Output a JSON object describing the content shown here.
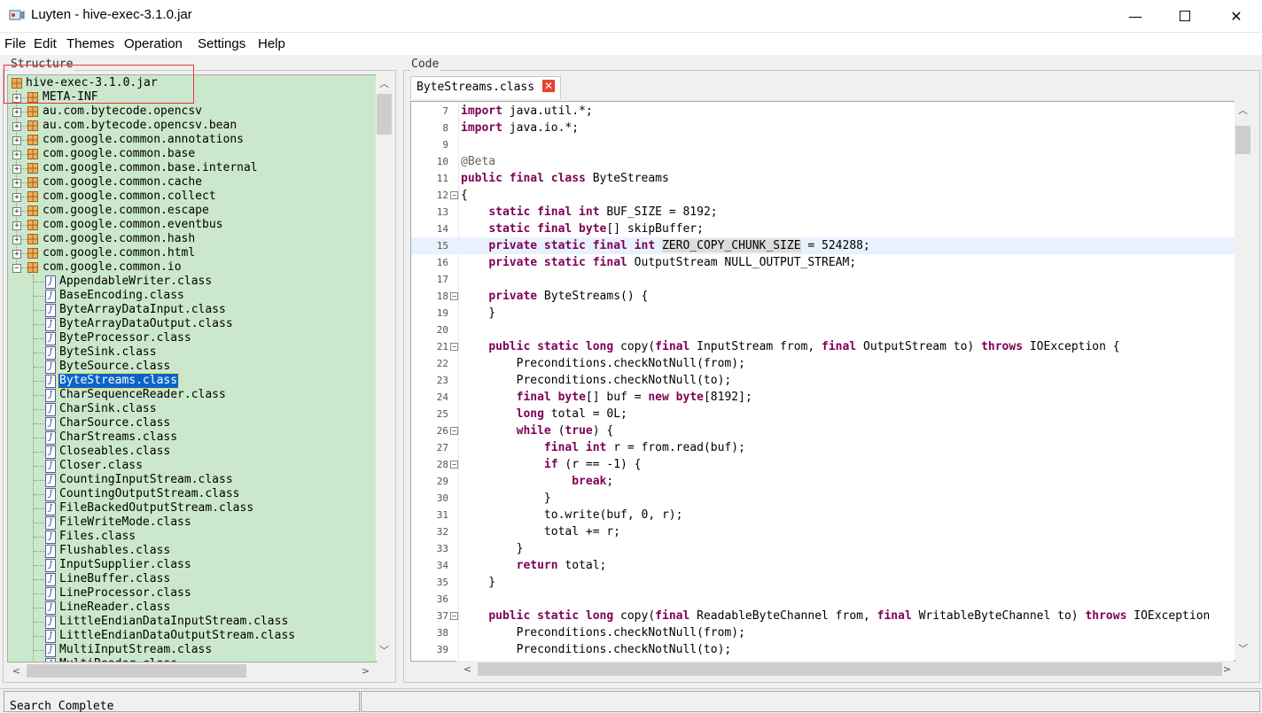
{
  "window": {
    "title": "Luyten - hive-exec-3.1.0.jar",
    "minimize_glyph": "—",
    "close_glyph": "✕"
  },
  "menu": [
    "File",
    "Edit",
    "Themes",
    "Operation",
    "Settings",
    "Help"
  ],
  "structure": {
    "label": "Structure",
    "tree": [
      {
        "label": "hive-exec-3.1.0.jar",
        "type": "jar",
        "level": 0,
        "expander": "",
        "selected": false
      },
      {
        "label": "META-INF",
        "type": "package",
        "level": 1,
        "expander": "+",
        "selected": false
      },
      {
        "label": "au.com.bytecode.opencsv",
        "type": "package",
        "level": 1,
        "expander": "+",
        "selected": false
      },
      {
        "label": "au.com.bytecode.opencsv.bean",
        "type": "package",
        "level": 1,
        "expander": "+",
        "selected": false
      },
      {
        "label": "com.google.common.annotations",
        "type": "package",
        "level": 1,
        "expander": "+",
        "selected": false
      },
      {
        "label": "com.google.common.base",
        "type": "package",
        "level": 1,
        "expander": "+",
        "selected": false
      },
      {
        "label": "com.google.common.base.internal",
        "type": "package",
        "level": 1,
        "expander": "+",
        "selected": false
      },
      {
        "label": "com.google.common.cache",
        "type": "package",
        "level": 1,
        "expander": "+",
        "selected": false
      },
      {
        "label": "com.google.common.collect",
        "type": "package",
        "level": 1,
        "expander": "+",
        "selected": false
      },
      {
        "label": "com.google.common.escape",
        "type": "package",
        "level": 1,
        "expander": "+",
        "selected": false
      },
      {
        "label": "com.google.common.eventbus",
        "type": "package",
        "level": 1,
        "expander": "+",
        "selected": false
      },
      {
        "label": "com.google.common.hash",
        "type": "package",
        "level": 1,
        "expander": "+",
        "selected": false
      },
      {
        "label": "com.google.common.html",
        "type": "package",
        "level": 1,
        "expander": "+",
        "selected": false
      },
      {
        "label": "com.google.common.io",
        "type": "package",
        "level": 1,
        "expander": "−",
        "selected": false
      },
      {
        "label": "AppendableWriter.class",
        "type": "class",
        "level": 2,
        "expander": "",
        "selected": false
      },
      {
        "label": "BaseEncoding.class",
        "type": "class",
        "level": 2,
        "expander": "",
        "selected": false
      },
      {
        "label": "ByteArrayDataInput.class",
        "type": "class",
        "level": 2,
        "expander": "",
        "selected": false
      },
      {
        "label": "ByteArrayDataOutput.class",
        "type": "class",
        "level": 2,
        "expander": "",
        "selected": false
      },
      {
        "label": "ByteProcessor.class",
        "type": "class",
        "level": 2,
        "expander": "",
        "selected": false
      },
      {
        "label": "ByteSink.class",
        "type": "class",
        "level": 2,
        "expander": "",
        "selected": false
      },
      {
        "label": "ByteSource.class",
        "type": "class",
        "level": 2,
        "expander": "",
        "selected": false
      },
      {
        "label": "ByteStreams.class",
        "type": "class",
        "level": 2,
        "expander": "",
        "selected": true
      },
      {
        "label": "CharSequenceReader.class",
        "type": "class",
        "level": 2,
        "expander": "",
        "selected": false
      },
      {
        "label": "CharSink.class",
        "type": "class",
        "level": 2,
        "expander": "",
        "selected": false
      },
      {
        "label": "CharSource.class",
        "type": "class",
        "level": 2,
        "expander": "",
        "selected": false
      },
      {
        "label": "CharStreams.class",
        "type": "class",
        "level": 2,
        "expander": "",
        "selected": false
      },
      {
        "label": "Closeables.class",
        "type": "class",
        "level": 2,
        "expander": "",
        "selected": false
      },
      {
        "label": "Closer.class",
        "type": "class",
        "level": 2,
        "expander": "",
        "selected": false
      },
      {
        "label": "CountingInputStream.class",
        "type": "class",
        "level": 2,
        "expander": "",
        "selected": false
      },
      {
        "label": "CountingOutputStream.class",
        "type": "class",
        "level": 2,
        "expander": "",
        "selected": false
      },
      {
        "label": "FileBackedOutputStream.class",
        "type": "class",
        "level": 2,
        "expander": "",
        "selected": false
      },
      {
        "label": "FileWriteMode.class",
        "type": "class",
        "level": 2,
        "expander": "",
        "selected": false
      },
      {
        "label": "Files.class",
        "type": "class",
        "level": 2,
        "expander": "",
        "selected": false
      },
      {
        "label": "Flushables.class",
        "type": "class",
        "level": 2,
        "expander": "",
        "selected": false
      },
      {
        "label": "InputSupplier.class",
        "type": "class",
        "level": 2,
        "expander": "",
        "selected": false
      },
      {
        "label": "LineBuffer.class",
        "type": "class",
        "level": 2,
        "expander": "",
        "selected": false
      },
      {
        "label": "LineProcessor.class",
        "type": "class",
        "level": 2,
        "expander": "",
        "selected": false
      },
      {
        "label": "LineReader.class",
        "type": "class",
        "level": 2,
        "expander": "",
        "selected": false
      },
      {
        "label": "LittleEndianDataInputStream.class",
        "type": "class",
        "level": 2,
        "expander": "",
        "selected": false
      },
      {
        "label": "LittleEndianDataOutputStream.class",
        "type": "class",
        "level": 2,
        "expander": "",
        "selected": false
      },
      {
        "label": "MultiInputStream.class",
        "type": "class",
        "level": 2,
        "expander": "",
        "selected": false
      },
      {
        "label": "MultiReader.class",
        "type": "class",
        "level": 2,
        "expander": "",
        "selected": false
      }
    ]
  },
  "code": {
    "label": "Code",
    "tab_label": "ByteStreams.class",
    "tab_close_glyph": "✕",
    "lines": [
      {
        "n": "7",
        "fold": false,
        "current": false,
        "tokens": [
          [
            "kw",
            "import"
          ],
          [
            "t",
            " java.util.*;"
          ]
        ]
      },
      {
        "n": "8",
        "fold": false,
        "current": false,
        "tokens": [
          [
            "kw",
            "import"
          ],
          [
            "t",
            " java.io.*;"
          ]
        ]
      },
      {
        "n": "9",
        "fold": false,
        "current": false,
        "tokens": []
      },
      {
        "n": "10",
        "fold": false,
        "current": false,
        "tokens": [
          [
            "ann",
            "@Beta"
          ]
        ]
      },
      {
        "n": "11",
        "fold": false,
        "current": false,
        "tokens": [
          [
            "kw",
            "public final class"
          ],
          [
            "t",
            " ByteStreams"
          ]
        ]
      },
      {
        "n": "12",
        "fold": true,
        "current": false,
        "tokens": [
          [
            "t",
            "{"
          ]
        ]
      },
      {
        "n": "13",
        "fold": false,
        "current": false,
        "tokens": [
          [
            "t",
            "    "
          ],
          [
            "kw",
            "static final int"
          ],
          [
            "t",
            " BUF_SIZE = 8192;"
          ]
        ]
      },
      {
        "n": "14",
        "fold": false,
        "current": false,
        "tokens": [
          [
            "t",
            "    "
          ],
          [
            "kw",
            "static final byte"
          ],
          [
            "t",
            "[] skipBuffer;"
          ]
        ]
      },
      {
        "n": "15",
        "fold": false,
        "current": true,
        "tokens": [
          [
            "t",
            "    "
          ],
          [
            "kw",
            "private static final int"
          ],
          [
            "t",
            " "
          ],
          [
            "occ",
            "ZERO_COPY_CHUNK_SIZE"
          ],
          [
            "t",
            " = 524288;"
          ]
        ]
      },
      {
        "n": "16",
        "fold": false,
        "current": false,
        "tokens": [
          [
            "t",
            "    "
          ],
          [
            "kw",
            "private static final"
          ],
          [
            "t",
            " OutputStream NULL_OUTPUT_STREAM;"
          ]
        ]
      },
      {
        "n": "17",
        "fold": false,
        "current": false,
        "tokens": []
      },
      {
        "n": "18",
        "fold": true,
        "current": false,
        "tokens": [
          [
            "t",
            "    "
          ],
          [
            "kw",
            "private"
          ],
          [
            "t",
            " ByteStreams() {"
          ]
        ]
      },
      {
        "n": "19",
        "fold": false,
        "current": false,
        "tokens": [
          [
            "t",
            "    }"
          ]
        ]
      },
      {
        "n": "20",
        "fold": false,
        "current": false,
        "tokens": []
      },
      {
        "n": "21",
        "fold": true,
        "current": false,
        "tokens": [
          [
            "t",
            "    "
          ],
          [
            "kw",
            "public static long"
          ],
          [
            "t",
            " copy("
          ],
          [
            "kw",
            "final"
          ],
          [
            "t",
            " InputStream from, "
          ],
          [
            "kw",
            "final"
          ],
          [
            "t",
            " OutputStream to) "
          ],
          [
            "kw",
            "throws"
          ],
          [
            "t",
            " IOException {"
          ]
        ]
      },
      {
        "n": "22",
        "fold": false,
        "current": false,
        "tokens": [
          [
            "t",
            "        Preconditions.checkNotNull(from);"
          ]
        ]
      },
      {
        "n": "23",
        "fold": false,
        "current": false,
        "tokens": [
          [
            "t",
            "        Preconditions.checkNotNull(to);"
          ]
        ]
      },
      {
        "n": "24",
        "fold": false,
        "current": false,
        "tokens": [
          [
            "t",
            "        "
          ],
          [
            "kw",
            "final byte"
          ],
          [
            "t",
            "[] buf = "
          ],
          [
            "kw",
            "new byte"
          ],
          [
            "t",
            "[8192];"
          ]
        ]
      },
      {
        "n": "25",
        "fold": false,
        "current": false,
        "tokens": [
          [
            "t",
            "        "
          ],
          [
            "kw",
            "long"
          ],
          [
            "t",
            " total = 0L;"
          ]
        ]
      },
      {
        "n": "26",
        "fold": true,
        "current": false,
        "tokens": [
          [
            "t",
            "        "
          ],
          [
            "kw",
            "while"
          ],
          [
            "t",
            " ("
          ],
          [
            "kw",
            "true"
          ],
          [
            "t",
            ") {"
          ]
        ]
      },
      {
        "n": "27",
        "fold": false,
        "current": false,
        "tokens": [
          [
            "t",
            "            "
          ],
          [
            "kw",
            "final int"
          ],
          [
            "t",
            " r = from.read(buf);"
          ]
        ]
      },
      {
        "n": "28",
        "fold": true,
        "current": false,
        "tokens": [
          [
            "t",
            "            "
          ],
          [
            "kw",
            "if"
          ],
          [
            "t",
            " (r == -1) {"
          ]
        ]
      },
      {
        "n": "29",
        "fold": false,
        "current": false,
        "tokens": [
          [
            "t",
            "                "
          ],
          [
            "kw",
            "break"
          ],
          [
            "t",
            ";"
          ]
        ]
      },
      {
        "n": "30",
        "fold": false,
        "current": false,
        "tokens": [
          [
            "t",
            "            }"
          ]
        ]
      },
      {
        "n": "31",
        "fold": false,
        "current": false,
        "tokens": [
          [
            "t",
            "            to.write(buf, 0, r);"
          ]
        ]
      },
      {
        "n": "32",
        "fold": false,
        "current": false,
        "tokens": [
          [
            "t",
            "            total += r;"
          ]
        ]
      },
      {
        "n": "33",
        "fold": false,
        "current": false,
        "tokens": [
          [
            "t",
            "        }"
          ]
        ]
      },
      {
        "n": "34",
        "fold": false,
        "current": false,
        "tokens": [
          [
            "t",
            "        "
          ],
          [
            "kw",
            "return"
          ],
          [
            "t",
            " total;"
          ]
        ]
      },
      {
        "n": "35",
        "fold": false,
        "current": false,
        "tokens": [
          [
            "t",
            "    }"
          ]
        ]
      },
      {
        "n": "36",
        "fold": false,
        "current": false,
        "tokens": []
      },
      {
        "n": "37",
        "fold": true,
        "current": false,
        "tokens": [
          [
            "t",
            "    "
          ],
          [
            "kw",
            "public static long"
          ],
          [
            "t",
            " copy("
          ],
          [
            "kw",
            "final"
          ],
          [
            "t",
            " ReadableByteChannel from, "
          ],
          [
            "kw",
            "final"
          ],
          [
            "t",
            " WritableByteChannel to) "
          ],
          [
            "kw",
            "throws"
          ],
          [
            "t",
            " IOException"
          ]
        ]
      },
      {
        "n": "38",
        "fold": false,
        "current": false,
        "tokens": [
          [
            "t",
            "        Preconditions.checkNotNull(from);"
          ]
        ]
      },
      {
        "n": "39",
        "fold": false,
        "current": false,
        "tokens": [
          [
            "t",
            "        Preconditions.checkNotNull(to);"
          ]
        ]
      }
    ]
  },
  "status": {
    "text": "Search Complete"
  },
  "colors": {
    "tree_background": "#cce8cc",
    "selection": "#0a64c8",
    "keyword": "#7f0055",
    "current_line": "#e8f2fe",
    "highlight_box": "#e0393e"
  }
}
